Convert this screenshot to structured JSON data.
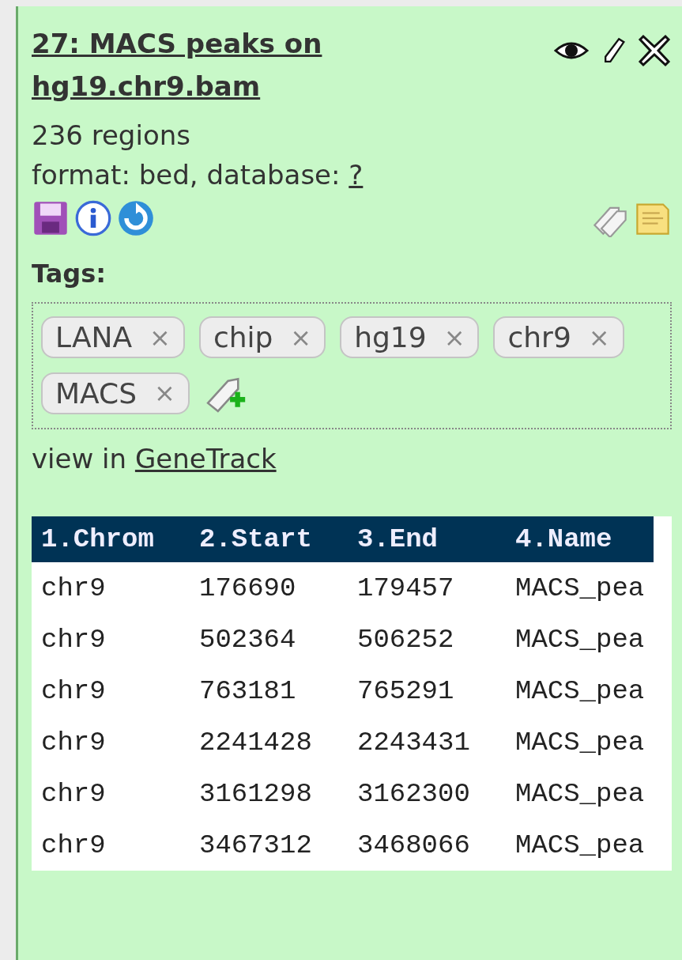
{
  "dataset": {
    "title": "27: MACS peaks on hg19.chr9.bam",
    "summary": "236 regions",
    "format_label": "format: bed, database: ",
    "database_link": "?"
  },
  "tags_label": "Tags:",
  "tags": [
    {
      "label": "LANA",
      "remove": "×"
    },
    {
      "label": "chip",
      "remove": "×"
    },
    {
      "label": "hg19",
      "remove": "×"
    },
    {
      "label": "chr9",
      "remove": "×"
    },
    {
      "label": "MACS",
      "remove": "×"
    }
  ],
  "view_text": "view in ",
  "view_link": "GeneTrack",
  "table": {
    "columns": [
      "1.Chrom",
      "2.Start",
      "3.End",
      "4.Name"
    ],
    "rows": [
      [
        "chr9",
        "176690",
        "179457",
        "MACS_pea"
      ],
      [
        "chr9",
        "502364",
        "506252",
        "MACS_pea"
      ],
      [
        "chr9",
        "763181",
        "765291",
        "MACS_pea"
      ],
      [
        "chr9",
        "2241428",
        "2243431",
        "MACS_pea"
      ],
      [
        "chr9",
        "3161298",
        "3162300",
        "MACS_pea"
      ],
      [
        "chr9",
        "3467312",
        "3468066",
        "MACS_pea"
      ]
    ]
  }
}
